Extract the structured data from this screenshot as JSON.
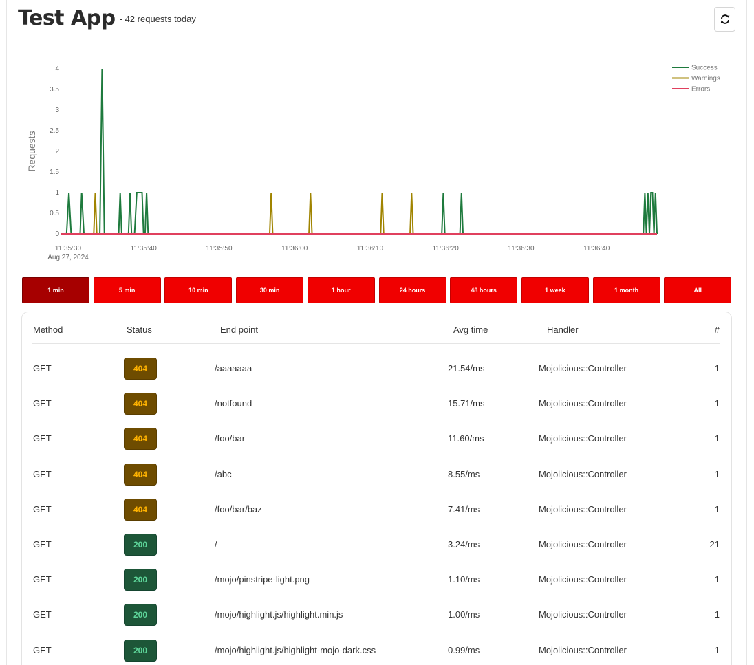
{
  "header": {
    "title": "Test App",
    "subtitle": "- 42 requests today"
  },
  "icons": {
    "refresh": "refresh-icon"
  },
  "colors": {
    "success": "#1e7a3d",
    "warnings": "#a08400",
    "errors": "#e0405e",
    "range_button": "#f00000",
    "range_button_active": "#a60000"
  },
  "chart_data": {
    "type": "line",
    "ylabel": "Requests",
    "ylim": [
      0,
      4
    ],
    "y_ticks": [
      "0",
      "0.5",
      "1",
      "1.5",
      "2",
      "2.5",
      "3",
      "3.5",
      "4"
    ],
    "x_ticks": [
      "11:35:30",
      "11:35:40",
      "11:35:50",
      "11:36:00",
      "11:36:10",
      "11:36:20",
      "11:36:30",
      "11:36:40"
    ],
    "x_date_label": "Aug 27, 2024",
    "x_start": "11:35:29",
    "x_end": "11:36:48",
    "legend_position": "top-right",
    "series": [
      {
        "name": "Success",
        "points": [
          [
            "11:35:29.8",
            0
          ],
          [
            "11:35:30.1",
            1
          ],
          [
            "11:35:30.4",
            0
          ],
          [
            "11:35:31.6",
            0
          ],
          [
            "11:35:31.8",
            1
          ],
          [
            "11:35:32.1",
            0
          ],
          [
            "11:35:34.2",
            0
          ],
          [
            "11:35:34.5",
            4
          ],
          [
            "11:35:34.8",
            0
          ],
          [
            "11:35:36.7",
            0
          ],
          [
            "11:35:36.9",
            1
          ],
          [
            "11:35:37.1",
            0
          ],
          [
            "11:35:38.0",
            0
          ],
          [
            "11:35:38.2",
            1
          ],
          [
            "11:35:38.4",
            0
          ],
          [
            "11:35:38.8",
            0
          ],
          [
            "11:35:39.1",
            1
          ],
          [
            "11:35:39.8",
            1
          ],
          [
            "11:35:40.0",
            0
          ],
          [
            "11:35:40.2",
            0
          ],
          [
            "11:35:40.4",
            1
          ],
          [
            "11:35:40.6",
            0
          ],
          [
            "11:36:19.5",
            0
          ],
          [
            "11:36:19.7",
            1
          ],
          [
            "11:36:19.9",
            0
          ],
          [
            "11:36:21.9",
            0
          ],
          [
            "11:36:22.1",
            1
          ],
          [
            "11:36:22.3",
            0
          ],
          [
            "11:36:46.2",
            0
          ],
          [
            "11:36:46.4",
            1
          ],
          [
            "11:36:46.6",
            0
          ],
          [
            "11:36:46.8",
            1
          ],
          [
            "11:36:47.0",
            0
          ],
          [
            "11:36:47.2",
            1
          ],
          [
            "11:36:47.4",
            1
          ],
          [
            "11:36:47.6",
            0
          ],
          [
            "11:36:47.8",
            1
          ],
          [
            "11:36:48.0",
            0
          ]
        ]
      },
      {
        "name": "Warnings",
        "points": [
          [
            "11:35:33.4",
            0
          ],
          [
            "11:35:33.6",
            1
          ],
          [
            "11:35:33.8",
            0
          ],
          [
            "11:35:56.7",
            0
          ],
          [
            "11:35:56.9",
            1
          ],
          [
            "11:35:57.1",
            0
          ],
          [
            "11:36:01.9",
            0
          ],
          [
            "11:36:02.1",
            1
          ],
          [
            "11:36:02.3",
            0
          ],
          [
            "11:36:11.4",
            0
          ],
          [
            "11:36:11.6",
            1
          ],
          [
            "11:36:11.8",
            0
          ],
          [
            "11:36:15.3",
            0
          ],
          [
            "11:36:15.5",
            1
          ],
          [
            "11:36:15.7",
            0
          ]
        ]
      },
      {
        "name": "Errors",
        "points": [
          [
            "11:35:29",
            0
          ],
          [
            "11:36:48",
            0
          ]
        ]
      }
    ]
  },
  "ranges": [
    "1 min",
    "5 min",
    "10 min",
    "30 min",
    "1 hour",
    "24 hours",
    "48 hours",
    "1 week",
    "1 month",
    "All"
  ],
  "active_range": 0,
  "table": {
    "headers": {
      "method": "Method",
      "status": "Status",
      "endpoint": "End point",
      "avg_time": "Avg time",
      "handler": "Handler",
      "count": "#"
    },
    "rows": [
      {
        "method": "GET",
        "status": "404",
        "endpoint": "/aaaaaaa",
        "avg_time": "21.54/ms",
        "handler": "Mojolicious::Controller",
        "count": "1"
      },
      {
        "method": "GET",
        "status": "404",
        "endpoint": "/notfound",
        "avg_time": "15.71/ms",
        "handler": "Mojolicious::Controller",
        "count": "1"
      },
      {
        "method": "GET",
        "status": "404",
        "endpoint": "/foo/bar",
        "avg_time": "11.60/ms",
        "handler": "Mojolicious::Controller",
        "count": "1"
      },
      {
        "method": "GET",
        "status": "404",
        "endpoint": "/abc",
        "avg_time": "8.55/ms",
        "handler": "Mojolicious::Controller",
        "count": "1"
      },
      {
        "method": "GET",
        "status": "404",
        "endpoint": "/foo/bar/baz",
        "avg_time": "7.41/ms",
        "handler": "Mojolicious::Controller",
        "count": "1"
      },
      {
        "method": "GET",
        "status": "200",
        "endpoint": "/",
        "avg_time": "3.24/ms",
        "handler": "Mojolicious::Controller",
        "count": "21"
      },
      {
        "method": "GET",
        "status": "200",
        "endpoint": "/mojo/pinstripe-light.png",
        "avg_time": "1.10/ms",
        "handler": "Mojolicious::Controller",
        "count": "1"
      },
      {
        "method": "GET",
        "status": "200",
        "endpoint": "/mojo/highlight.js/highlight.min.js",
        "avg_time": "1.00/ms",
        "handler": "Mojolicious::Controller",
        "count": "1"
      },
      {
        "method": "GET",
        "status": "200",
        "endpoint": "/mojo/highlight.js/highlight-mojo-dark.css",
        "avg_time": "0.99/ms",
        "handler": "Mojolicious::Controller",
        "count": "1"
      }
    ]
  }
}
